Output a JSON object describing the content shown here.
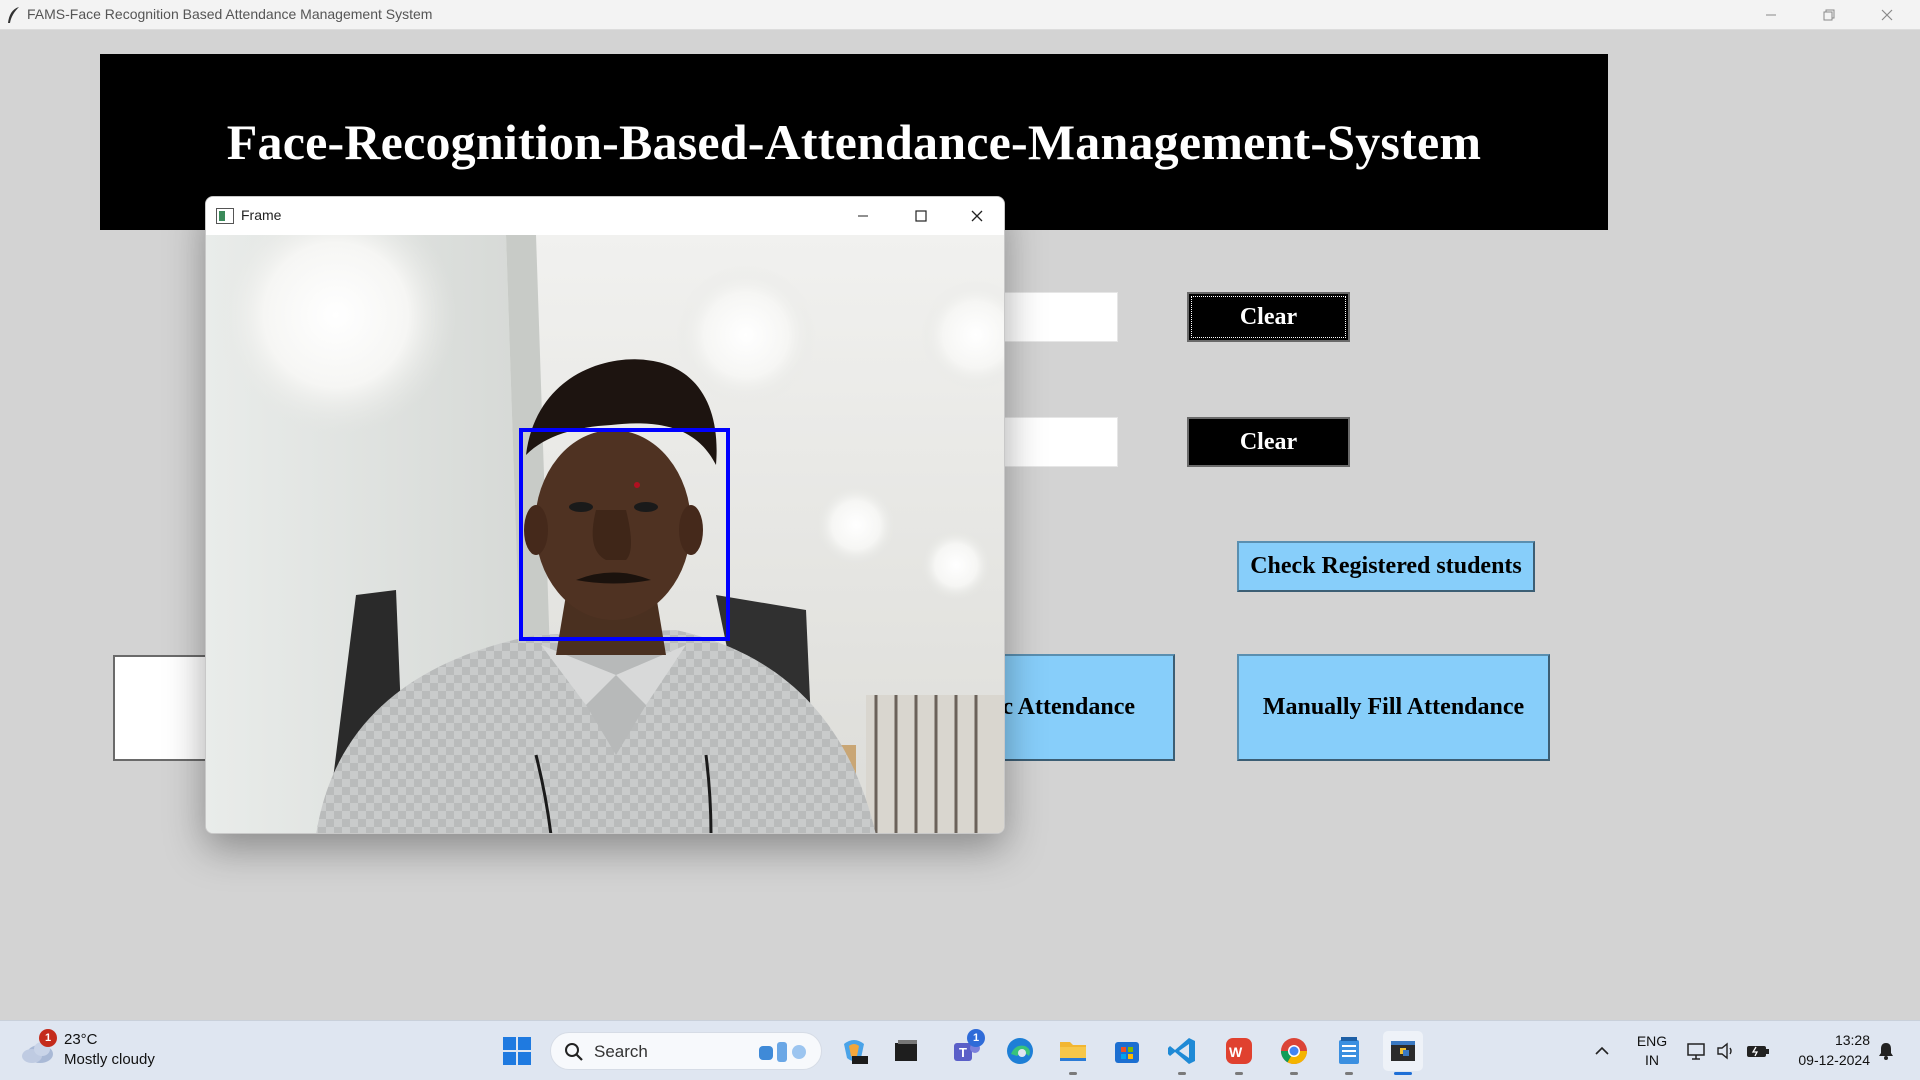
{
  "window": {
    "title": "FAMS-Face Recognition Based Attendance Management System"
  },
  "banner": {
    "title": "Face-Recognition-Based-Attendance-Management-System"
  },
  "form": {
    "clear_button_1": "Clear",
    "clear_button_2": "Clear",
    "check_registered_button": "Check Registered students",
    "automatic_attendance_button": "Automatic Attendance",
    "manual_attendance_button": "Manually Fill Attendance"
  },
  "camera_window": {
    "title": "Frame",
    "face_detected": true,
    "detection_box_color": "#0000ff"
  },
  "taskbar": {
    "weather": {
      "temperature": "23°C",
      "condition": "Mostly cloudy",
      "badge_count": "1"
    },
    "search_placeholder": "Search",
    "teams_badge": "1",
    "language": "ENG",
    "region": "IN",
    "time": "13:28",
    "date": "09-12-2024"
  }
}
